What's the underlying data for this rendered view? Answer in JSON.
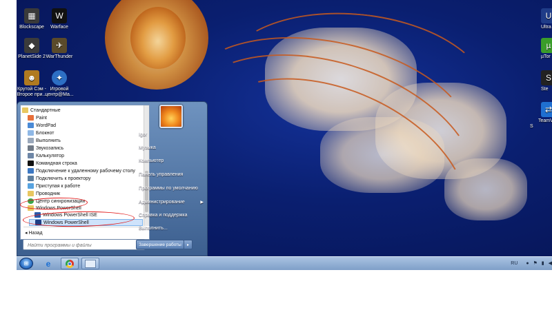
{
  "desktop_icons": [
    {
      "label": "Blockscape",
      "icon": "blockscape-icon",
      "color": "#3a3a3a"
    },
    {
      "label": "Warface",
      "icon": "warface-icon",
      "color": "#111111"
    },
    {
      "label": "PlanetSide 2",
      "icon": "planetside-icon",
      "color": "#3b3b3b"
    },
    {
      "label": "WarThunder",
      "icon": "warthunder-icon",
      "color": "#5a4a2a"
    },
    {
      "label": "Крутой Сэм - Второе при...",
      "icon": "serious-sam-icon",
      "color": "#b07a20"
    },
    {
      "label": "Игровой центр@Ma...",
      "icon": "game-center-icon",
      "color": "#2d6fc4"
    },
    {
      "label": "Ultra",
      "icon": "ultra-icon",
      "color": "#1f3c88"
    },
    {
      "label": "µTor",
      "icon": "utorrent-icon",
      "color": "#3a9d2a"
    },
    {
      "label": "Ste",
      "icon": "steam-icon",
      "color": "#222222"
    },
    {
      "label": "TeamV\nS",
      "icon": "teamviewer-icon",
      "color": "#1f6fd1"
    }
  ],
  "start_menu": {
    "programs": [
      {
        "label": "Стандартные",
        "icon": "folder-icon"
      },
      {
        "label": "Paint",
        "icon": "paint-icon"
      },
      {
        "label": "WordPad",
        "icon": "wordpad-icon"
      },
      {
        "label": "Блокнот",
        "icon": "notepad-icon"
      },
      {
        "label": "Выполнить",
        "icon": "run-icon"
      },
      {
        "label": "Звукозапись",
        "icon": "sound-recorder-icon"
      },
      {
        "label": "Калькулятор",
        "icon": "calculator-icon"
      },
      {
        "label": "Командная строка",
        "icon": "cmd-icon"
      },
      {
        "label": "Подключение к удаленному рабочему столу",
        "icon": "remote-desktop-icon"
      },
      {
        "label": "Подключить к проектору",
        "icon": "projector-icon"
      },
      {
        "label": "Приступая к работе",
        "icon": "getting-started-icon"
      },
      {
        "label": "Проводник",
        "icon": "explorer-icon"
      },
      {
        "label": "Центр синхронизации",
        "icon": "sync-center-icon"
      },
      {
        "label": "Windows PowerShell",
        "icon": "folder-icon"
      },
      {
        "label": "Windows PowerShell ISE",
        "icon": "powershell-ise-icon"
      },
      {
        "label": "Windows PowerShell",
        "icon": "powershell-icon"
      }
    ],
    "back_label": "Назад",
    "search_placeholder": "Найти программы и файлы",
    "right_items": [
      {
        "label": "Igor",
        "has_arrow": false
      },
      {
        "label": "Музыка",
        "has_arrow": false
      },
      {
        "label": "Компьютер",
        "has_arrow": false
      },
      {
        "label": "Панель управления",
        "has_arrow": false
      },
      {
        "label": "Программы по умолчанию",
        "has_arrow": false
      },
      {
        "label": "Администрирование",
        "has_arrow": true
      },
      {
        "label": "Справка и поддержка",
        "has_arrow": false
      },
      {
        "label": "Выполнить...",
        "has_arrow": false
      }
    ],
    "shutdown_label": "Завершение работы"
  },
  "taskbar": {
    "pinned": [
      "ie-icon",
      "chrome-icon",
      "explorer-window-icon"
    ],
    "language": "RU"
  },
  "colors": {
    "annotation": "#e01818",
    "selection": "#cfe3fb"
  }
}
